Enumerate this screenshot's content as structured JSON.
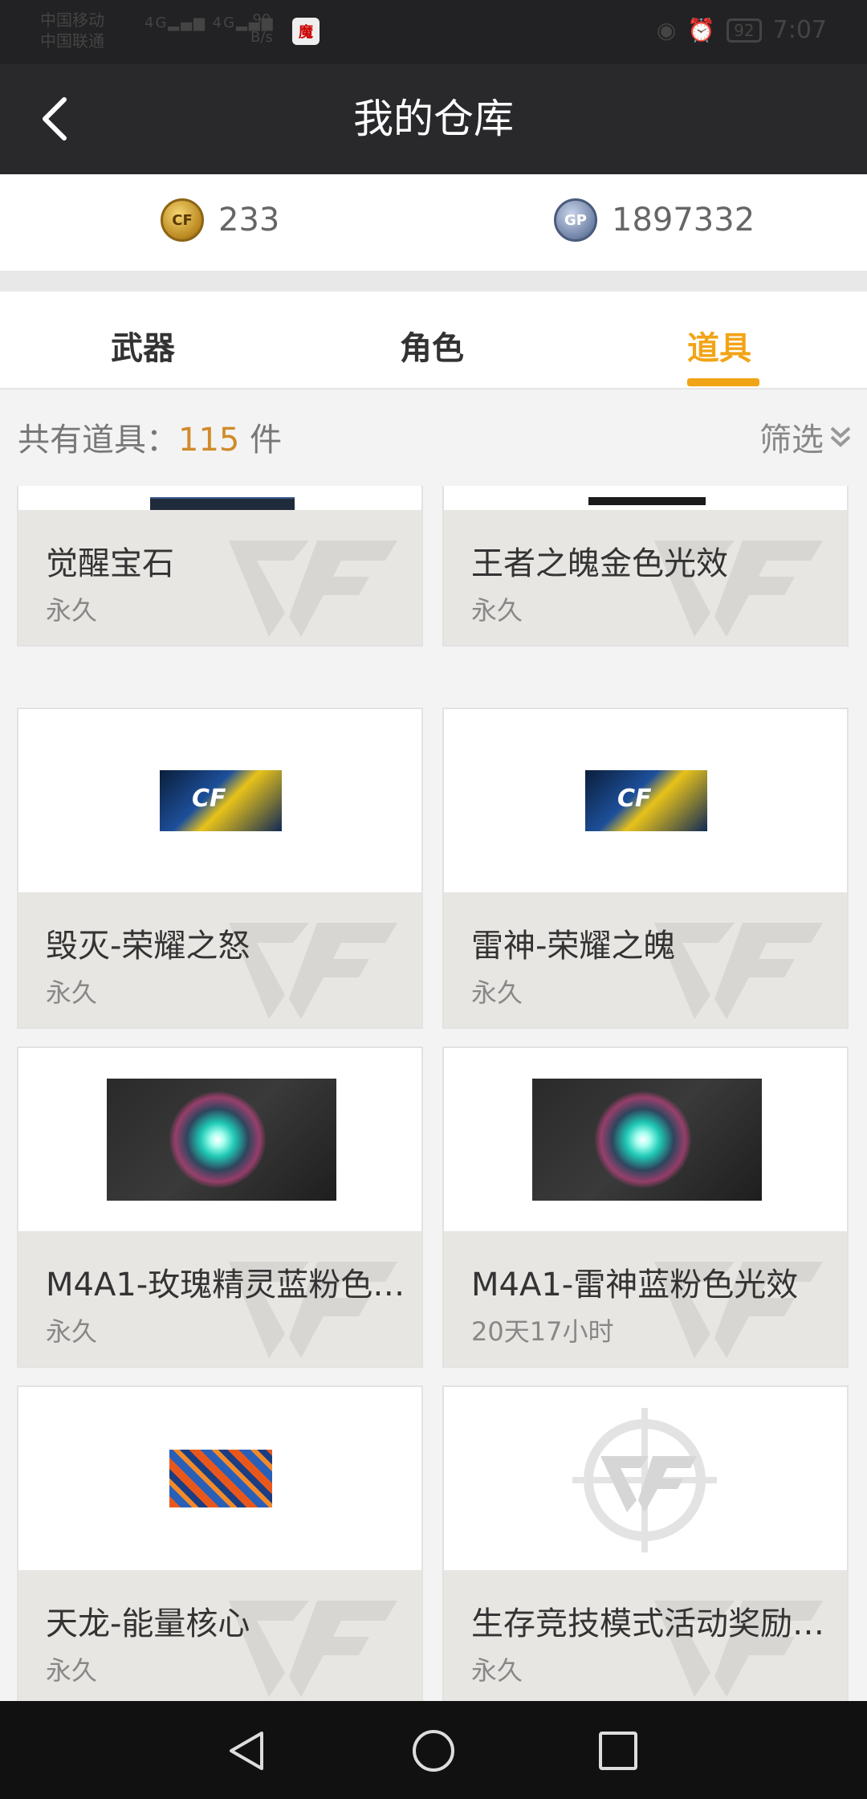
{
  "status_bar": {
    "carrier1": "中国移动",
    "carrier2": "中国联通",
    "net1": "4G",
    "net2": "4G",
    "speed_value": "90",
    "speed_unit": "B/s",
    "app_icon_text": "魔",
    "battery": "92",
    "time": "7:07"
  },
  "header": {
    "title": "我的仓库",
    "back_icon": "chevron-left-icon"
  },
  "currency": {
    "cf_points": "233",
    "cf_icon_text": "CF",
    "gp_points": "1897332",
    "gp_icon_text": "GP"
  },
  "tabs": [
    {
      "label": "武器",
      "active": false
    },
    {
      "label": "角色",
      "active": false
    },
    {
      "label": "道具",
      "active": true
    }
  ],
  "summary": {
    "prefix": "共有道具：",
    "count": "115",
    "suffix": " 件",
    "filter_label": "筛选"
  },
  "items": [
    {
      "name": "觉醒宝石",
      "duration": "永久",
      "thumb": "dark-strip"
    },
    {
      "name": "王者之魄金色光效",
      "duration": "永久",
      "thumb": "dark-strip"
    },
    {
      "name": "毁灭-荣耀之怒",
      "duration": "永久",
      "thumb": "cfpl-logo"
    },
    {
      "name": "雷神-荣耀之魄",
      "duration": "永久",
      "thumb": "cfpl-logo"
    },
    {
      "name": "M4A1-玫瑰精灵蓝粉色…",
      "duration": "永久",
      "thumb": "glow-orb"
    },
    {
      "name": "M4A1-雷神蓝粉色光效",
      "duration": "20天17小时",
      "thumb": "glow-orb"
    },
    {
      "name": "天龙-能量核心",
      "duration": "永久",
      "thumb": "camo"
    },
    {
      "name": "生存竞技模式活动奖励…",
      "duration": "永久",
      "thumb": "cf-emblem"
    }
  ],
  "colors": {
    "accent": "#f2a417",
    "header_bg": "#29292b",
    "card_bottom": "#e8e6e3"
  }
}
